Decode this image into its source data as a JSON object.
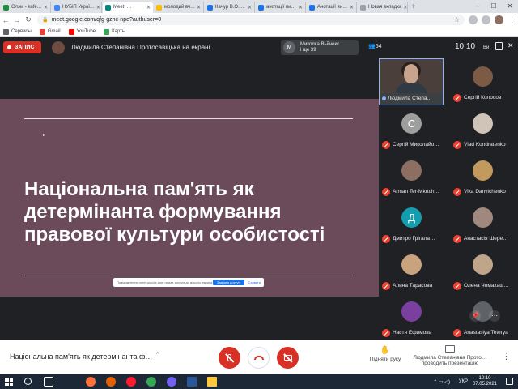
{
  "browser": {
    "tabs": [
      {
        "label": "Слэм - kafe…",
        "color": "#1e8e3e",
        "active": false
      },
      {
        "label": "НУБіП Украї…",
        "color": "#4285f4",
        "active": false
      },
      {
        "label": "Meet: …",
        "color": "#00897b",
        "active": true
      },
      {
        "label": "молодий вч…",
        "color": "#fbbc04",
        "active": false
      },
      {
        "label": "Качур В.О.…",
        "color": "#1a73e8",
        "active": false
      },
      {
        "label": "анотації ви…",
        "color": "#1a73e8",
        "active": false
      },
      {
        "label": "Анотації ви…",
        "color": "#1a73e8",
        "active": false
      },
      {
        "label": "Новая вкладка",
        "color": "#9aa0a6",
        "active": false
      }
    ],
    "url": "meet.google.com/qfg-gzhc-npe?authuser=0",
    "bookmarks": [
      {
        "label": "Сервисы",
        "color": "#5f6368"
      },
      {
        "label": "Gmail",
        "color": "#ea4335"
      },
      {
        "label": "YouTube",
        "color": "#ff0000"
      },
      {
        "label": "Карты",
        "color": "#34a853"
      }
    ]
  },
  "meet": {
    "record_label": "ЗАПИС",
    "presenter_title": "Людмила Степанівна Протосавіцька на екрані",
    "chip_line1": "Миколка Вьйчекс",
    "chip_line2": "і ще 39",
    "chip_letter": "M",
    "people_count": "54",
    "clock": "10:10",
    "clock_suffix": "Ви",
    "accent_record": "#d93025"
  },
  "slide": {
    "title": "Національна пам'ять як детермінанта формування правової культури особистості",
    "share_text": "Повідомлення meet.google.com надає доступ до вашого екрана",
    "share_stop": "Закрити доступ",
    "share_hide": "Сховати",
    "background": "#6b4a5a"
  },
  "participants": [
    {
      "name": "Людмила Степа…",
      "initial": "",
      "avatar_color": "#4a3f3a",
      "speaker": true
    },
    {
      "name": "Сергій Колосов",
      "initial": "",
      "avatar_color": "#7c5a44",
      "speaker": false
    },
    {
      "name": "Сергій Миколайо…",
      "initial": "С",
      "avatar_color": "#9e9e9e",
      "speaker": false
    },
    {
      "name": "Vlad Kondratenko",
      "initial": "",
      "avatar_color": "#d0c4b8",
      "speaker": false
    },
    {
      "name": "Arman Ter-Mkrtch…",
      "initial": "",
      "avatar_color": "#8d6e63",
      "speaker": false
    },
    {
      "name": "Vika Danylchenko",
      "initial": "",
      "avatar_color": "#c29a5e",
      "speaker": false
    },
    {
      "name": "Дмитро Грігала…",
      "initial": "Д",
      "avatar_color": "#129eaf",
      "speaker": false
    },
    {
      "name": "Анастасія Шере…",
      "initial": "",
      "avatar_color": "#a1887f",
      "speaker": false
    },
    {
      "name": "Алина Тарасова",
      "initial": "",
      "avatar_color": "#c9a27e",
      "speaker": false
    },
    {
      "name": "Олена Чомахаш…",
      "initial": "",
      "avatar_color": "#bfa58a",
      "speaker": false
    },
    {
      "name": "Настя Ефимова",
      "initial": "",
      "avatar_color": "#7b3fa0",
      "speaker": false
    },
    {
      "name": "Anastasiya Teterya",
      "initial": "",
      "avatar_color": "#5f6368",
      "speaker": false
    }
  ],
  "controls": {
    "meeting_title": "Національна пам'ять як детермінанта ф…",
    "raise_hand": "Підняти руку",
    "presenting_line1": "Людмила Степанівна Прото…",
    "presenting_line2": "проводить презентацію"
  },
  "taskbar": {
    "lang": "УКР",
    "time": "10:10",
    "date": "07.05.2021",
    "apps": [
      {
        "name": "firefox-icon",
        "color": "#ff7139"
      },
      {
        "name": "firefox-dev-icon",
        "color": "#e66000"
      },
      {
        "name": "opera-icon",
        "color": "#ff1b2d"
      },
      {
        "name": "chrome-icon",
        "color": "#34a853"
      },
      {
        "name": "viber-icon",
        "color": "#7360f2"
      },
      {
        "name": "word-icon",
        "color": "#2b579a"
      },
      {
        "name": "explorer-icon",
        "color": "#ffc83d"
      }
    ]
  }
}
